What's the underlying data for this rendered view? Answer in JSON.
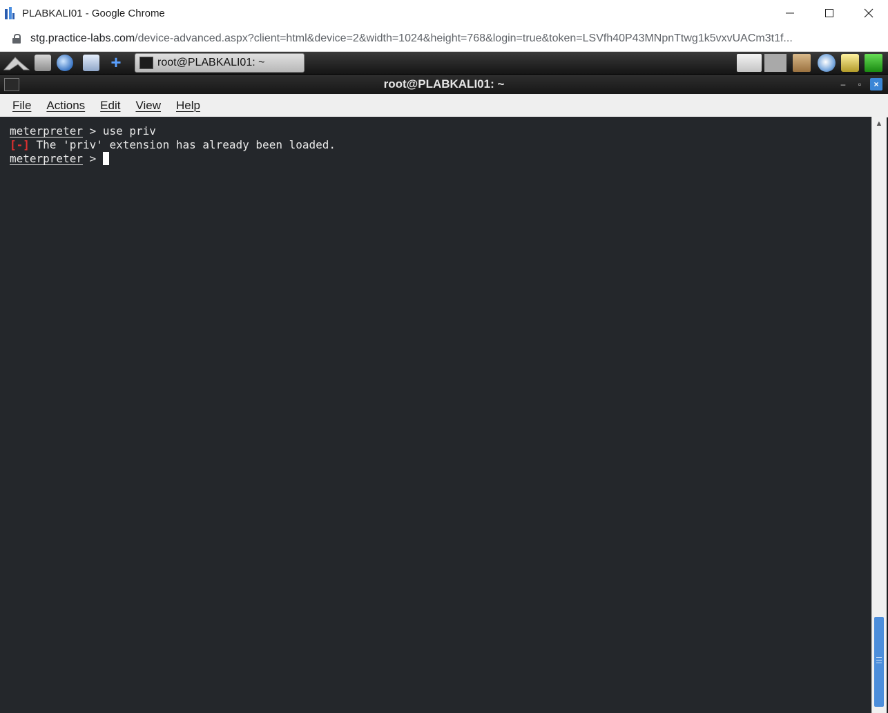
{
  "chrome": {
    "window_title": "PLABKALI01 - Google Chrome",
    "url_domain": "stg.practice-labs.com",
    "url_rest": "/device-advanced.aspx?client=html&device=2&width=1024&height=768&login=true&token=LSVfh40P43MNpnTtwg1k5vxvUACm3t1f..."
  },
  "panel": {
    "taskbar_item_label": "root@PLABKALI01: ~"
  },
  "terminal": {
    "title": "root@PLABKALI01: ~",
    "menu": [
      "File",
      "Actions",
      "Edit",
      "View",
      "Help"
    ],
    "lines": [
      {
        "prompt": "meterpreter",
        "text": " > use priv"
      },
      {
        "marker": "[-]",
        "text": " The 'priv' extension has already been loaded."
      },
      {
        "prompt": "meterpreter",
        "text": " > "
      }
    ]
  },
  "icons": {
    "title_min": "minimize-icon",
    "title_max": "maximize-icon",
    "title_close": "close-icon",
    "lock": "lock-icon"
  },
  "colors": {
    "terminal_bg": "#24272b",
    "error_red": "#e03030",
    "accent_blue": "#4c8edb"
  }
}
